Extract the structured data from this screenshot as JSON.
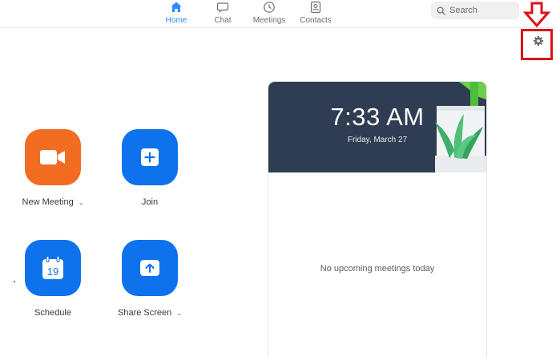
{
  "nav": {
    "tabs": [
      {
        "label": "Home",
        "icon": "home-icon",
        "active": true
      },
      {
        "label": "Chat",
        "icon": "chat-bubble-icon",
        "active": false
      },
      {
        "label": "Meetings",
        "icon": "clock-icon",
        "active": false
      },
      {
        "label": "Contacts",
        "icon": "contact-card-icon",
        "active": false
      }
    ],
    "search": {
      "placeholder": "Search",
      "icon": "search-icon"
    },
    "settings_icon": "gear-icon"
  },
  "actions": [
    {
      "label": "New Meeting",
      "icon": "video-camera-icon",
      "color": "#f26d21",
      "has_dropdown": true
    },
    {
      "label": "Join",
      "icon": "plus-icon",
      "color": "#0e72ed",
      "has_dropdown": false
    },
    {
      "label": "Schedule",
      "icon": "calendar-icon",
      "color": "#0e72ed",
      "has_dropdown": false,
      "calendar_day": "19"
    },
    {
      "label": "Share Screen",
      "icon": "share-up-arrow-icon",
      "color": "#0e72ed",
      "has_dropdown": true
    }
  ],
  "card": {
    "time": "7:33 AM",
    "date": "Friday, March 27",
    "empty_message": "No upcoming meetings today"
  },
  "colors": {
    "accent": "#2d8cff",
    "annotation": "#d9141b",
    "banner": "#2f3d52"
  }
}
